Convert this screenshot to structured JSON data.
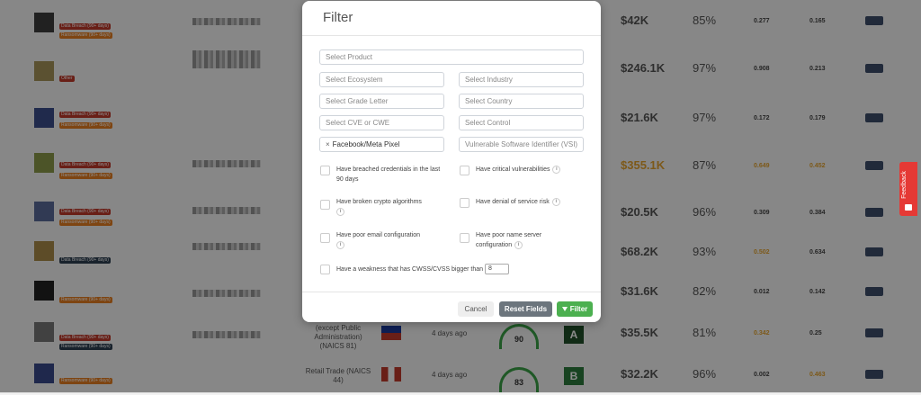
{
  "modal": {
    "title": "Filter",
    "product_placeholder": "Select Product",
    "ecosystem_placeholder": "Select Ecosystem",
    "industry_placeholder": "Select Industry",
    "grade_placeholder": "Select Grade Letter",
    "country_placeholder": "Select Country",
    "cve_placeholder": "Select CVE or CWE",
    "control_placeholder": "Select Control",
    "selected_chip": "Facebook/Meta Pixel",
    "vsi_placeholder": "Vulnerable Software Identifier (VSI)",
    "checkboxes": {
      "breached": "Have breached credentials in the last 90 days",
      "critical": "Have critical vulnerabilities",
      "crypto": "Have broken crypto algorithms",
      "dos": "Have denial of service risk",
      "email": "Have poor email configuration",
      "nameserver": "Have poor name server configuration",
      "cwss": "Have a weakness that has CWSS/CVSS bigger than"
    },
    "cwss_value": "8",
    "cancel_label": "Cancel",
    "reset_label": "Reset Fields",
    "filter_label": "Filter"
  },
  "feedback_label": "Feedback",
  "rows": [
    {
      "price": "$42K",
      "pct": "85%",
      "v1": "0.277",
      "v2": "0.165"
    },
    {
      "price": "$246.1K",
      "pct": "97%",
      "v1": "0.908",
      "v2": "0.213"
    },
    {
      "price": "$21.6K",
      "pct": "97%",
      "v1": "0.172",
      "v2": "0.179"
    },
    {
      "price": "$355.1K",
      "pct": "87%",
      "v1": "0.649",
      "v2": "0.452"
    },
    {
      "price": "$20.5K",
      "pct": "96%",
      "v1": "0.309",
      "v2": "0.384"
    },
    {
      "price": "$68.2K",
      "pct": "93%",
      "v1": "0.502",
      "v2": "0.634"
    },
    {
      "price": "$31.6K",
      "pct": "82%",
      "v1": "0.012",
      "v2": "0.142"
    },
    {
      "price": "$35.5K",
      "pct": "81%",
      "v1": "0.342",
      "v2": "0.25"
    },
    {
      "price": "$32.2K",
      "pct": "96%",
      "v1": "0.002",
      "v2": "0.463"
    }
  ],
  "extra": {
    "industry_1": "(except Public Administration) (NAICS 81)",
    "industry_2": "Retail Trade (NAICS 44)",
    "days_ago": "4 days ago",
    "gauge_1": "90",
    "gauge_2": "83",
    "grade_1": "A",
    "grade_2": "B"
  },
  "tags": {
    "data_breach": "Data Breach (90+ days)",
    "ransomware": "Ransomware (90+ days)",
    "other": "Other"
  }
}
